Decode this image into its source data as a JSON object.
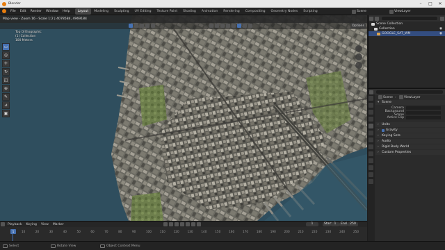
{
  "window": {
    "title": "Blender",
    "controls": [
      "–",
      "□",
      "✕"
    ]
  },
  "menubar": {
    "menus": [
      "File",
      "Edit",
      "Render",
      "Window",
      "Help"
    ],
    "workspaces": [
      "Layout",
      "Modeling",
      "Sculpting",
      "UV Editing",
      "Texture Paint",
      "Shading",
      "Animation",
      "Rendering",
      "Compositing",
      "Geometry Nodes",
      "Scripting"
    ],
    "active_workspace": "Layout",
    "scene_label": "Scene",
    "view_layer_label": "ViewLayer"
  },
  "viewport": {
    "header_status": "Map view - Zoom 16 - Scale 1:2 | 4078584, 4969184",
    "overlay": {
      "view_name": "Top Orthographic",
      "collection": "(1) Collection",
      "scale": "100 Meters"
    },
    "options_label": "Options",
    "tools": [
      "select-box",
      "cursor",
      "move",
      "rotate",
      "scale",
      "transform",
      "annotate",
      "measure",
      "add-cube"
    ]
  },
  "timeline": {
    "menus": [
      "Playback",
      "Keying",
      "View",
      "Marker"
    ],
    "current_frame": "1",
    "start_label": "Start",
    "start_value": "1",
    "end_label": "End",
    "end_value": "250",
    "ruler": [
      "10",
      "20",
      "30",
      "40",
      "50",
      "60",
      "70",
      "80",
      "90",
      "100",
      "110",
      "120",
      "130",
      "140",
      "150",
      "160",
      "170",
      "180",
      "190",
      "200",
      "210",
      "220",
      "230",
      "240",
      "250"
    ]
  },
  "statusbar": {
    "select": "Select",
    "rotate_view": "Rotate View",
    "context_menu": "Object Context Menu"
  },
  "outliner": {
    "title": "Scene Collection",
    "items": [
      {
        "label": "Collection",
        "color": "#d8d8d8"
      },
      {
        "label": "GOOGLE_SAT_WM",
        "color": "#e0a64b"
      }
    ]
  },
  "properties": {
    "breadcrumb_scene": "Scene",
    "breadcrumb_layer": "ViewLayer",
    "scene_panel": "Scene",
    "camera_label": "Camera",
    "background_scene_label": "Background Scene",
    "active_clip_label": "Active Clip",
    "units_panel": "Units",
    "gravity_label": "Gravity",
    "keying_sets_panel": "Keying Sets",
    "audio_panel": "Audio",
    "rigid_body_panel": "Rigid Body World",
    "custom_props_panel": "Custom Properties"
  },
  "colors": {
    "accent": "#4772b3",
    "blender_orange": "#e87d0d",
    "water": "#2f4e5e"
  }
}
